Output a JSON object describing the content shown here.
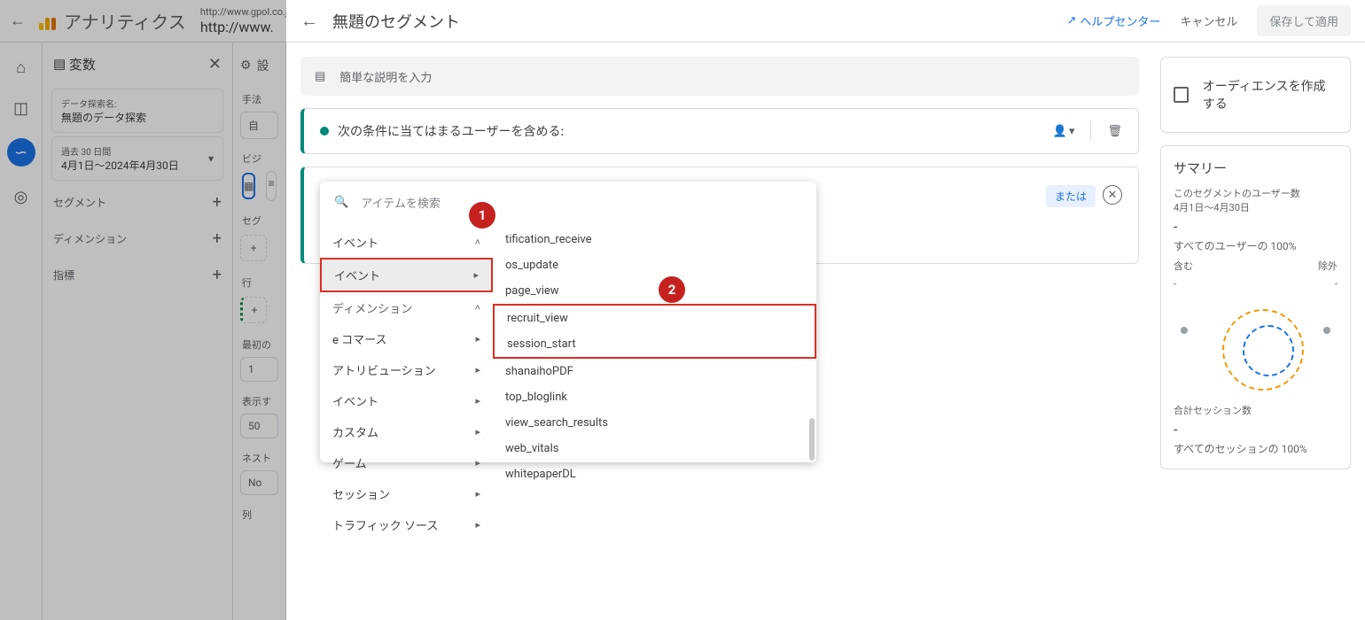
{
  "topbar": {
    "app": "アナリティクス",
    "url_small": "http://www.gpol.co.jp",
    "url_big": "http://www."
  },
  "vars": {
    "title": "変数",
    "explore_label": "データ探索名:",
    "explore_value": "無題のデータ探索",
    "range_label": "過去 30 日間",
    "range_value": "4月1日～2024年4月30日",
    "sections": {
      "segment": "セグメント",
      "dimension": "ディメンション",
      "metric": "指標"
    }
  },
  "settings": {
    "header": "設",
    "method": "手法",
    "method_val": "自",
    "vis": "ビジ",
    "seg": "セグ",
    "row": "行",
    "first": "最初の",
    "first_val": "1",
    "show": "表示す",
    "show_val": "50",
    "nest": "ネスト",
    "nest_val": "No",
    "col": "列"
  },
  "builder": {
    "title": "無題のセグメント",
    "help": "ヘルプセンター",
    "cancel": "キャンセル",
    "save": "保存して適用",
    "desc_placeholder": "簡単な説明を入力",
    "include_label": "次の条件に当てはまるユーザーを含める:",
    "or": "または",
    "search_placeholder": "アイテムを検索"
  },
  "categories": [
    {
      "label": "イベント",
      "state": "collapsed"
    },
    {
      "label": "イベント",
      "state": "highlight"
    },
    {
      "label": "ディメンション",
      "state": "expanded"
    },
    {
      "label": "e コマース",
      "state": "sub"
    },
    {
      "label": "アトリビューション",
      "state": "sub"
    },
    {
      "label": "イベント",
      "state": "sub"
    },
    {
      "label": "カスタム",
      "state": "sub"
    },
    {
      "label": "ゲーム",
      "state": "sub"
    },
    {
      "label": "セッション",
      "state": "sub"
    },
    {
      "label": "トラフィック ソース",
      "state": "sub"
    }
  ],
  "events": [
    "tification_receive",
    "os_update",
    "page_view",
    "recruit_view",
    "session_start",
    "shanaihoPDF",
    "top_bloglink",
    "view_search_results",
    "web_vitals",
    "whitepaperDL"
  ],
  "audience": {
    "create": "オーディエンスを作成する"
  },
  "summary": {
    "title": "サマリー",
    "users_label": "このセグメントのユーザー数",
    "range": "4月1日～4月30日",
    "users_val": "-",
    "all_users": "すべてのユーザーの 100%",
    "include": "含む",
    "exclude": "除外",
    "inc_val": "-",
    "exc_val": "-",
    "sess_label": "合計セッション数",
    "sess_val": "-",
    "all_sess": "すべてのセッションの 100%"
  }
}
